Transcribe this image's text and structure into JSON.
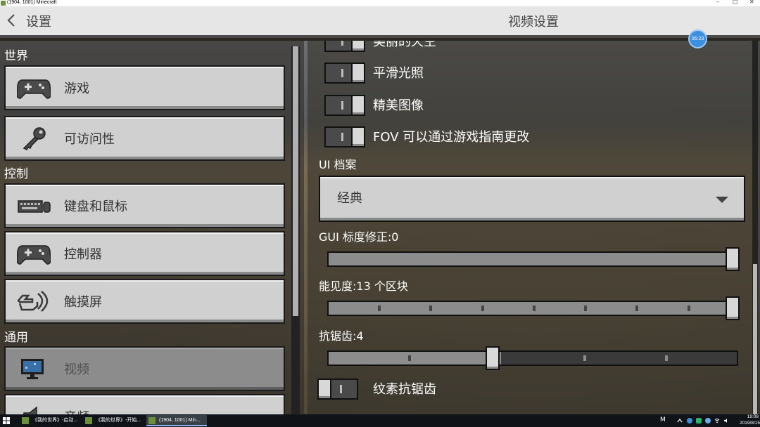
{
  "window": {
    "title": "(1904, 1001) Minecraft",
    "minimize": "–",
    "maximize": "□",
    "close": "✕"
  },
  "header": {
    "back_label": "设置",
    "page_title": "视频设置",
    "back_icon": "chevron-left-icon"
  },
  "clock_badge": "06:23",
  "sidebar": {
    "sections": [
      {
        "label": "世界",
        "items": [
          {
            "label": "游戏",
            "icon": "gamepad-icon"
          },
          {
            "label": "可访问性",
            "icon": "key-icon"
          }
        ]
      },
      {
        "label": "控制",
        "items": [
          {
            "label": "键盘和鼠标",
            "icon": "keyboard-mouse-icon"
          },
          {
            "label": "控制器",
            "icon": "controller-icon"
          },
          {
            "label": "触摸屏",
            "icon": "touch-hand-icon"
          }
        ]
      },
      {
        "label": "通用",
        "items": [
          {
            "label": "视频",
            "icon": "monitor-icon",
            "selected": true
          },
          {
            "label": "音频",
            "icon": "speaker-icon"
          }
        ]
      }
    ]
  },
  "video_settings": {
    "toggles": [
      {
        "label": "美丽的天空",
        "on": true
      },
      {
        "label": "平滑光照",
        "on": true
      },
      {
        "label": "精美图像",
        "on": true
      },
      {
        "label": "FOV 可以通过游戏指南更改",
        "on": true
      }
    ],
    "ui_profile": {
      "heading": "UI 档案",
      "value": "经典"
    },
    "gui_scale": {
      "label": "GUI 标度修正:0",
      "fraction": 1.0
    },
    "render_distance": {
      "label": "能见度:13 个区块",
      "fraction": 1.0
    },
    "antialiasing": {
      "label": "抗锯齿:4",
      "fraction": 0.4
    },
    "texture_aa": {
      "label": "纹素抗锯齿",
      "on": false
    }
  },
  "taskbar": {
    "tasks": [
      {
        "label": "《我的世界》-启动...",
        "active": false
      },
      {
        "label": "《我的世界》-开始...",
        "active": false
      },
      {
        "label": "(1904, 1001) Min...",
        "active": true
      }
    ],
    "ime": "M",
    "time": "19:08",
    "date": "2019/8/15"
  },
  "colors": {
    "button_face": "#d0d0d0",
    "button_selected": "#8c8c8c",
    "accent_badge": "#3d8fe0",
    "header_bg": "#e6e6e6"
  }
}
